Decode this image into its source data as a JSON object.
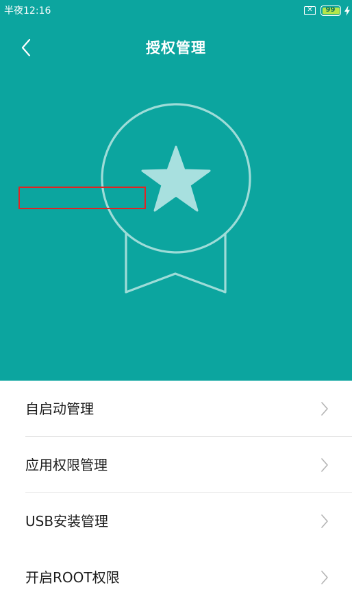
{
  "status_bar": {
    "time": "半夜12:16",
    "battery_level": "99",
    "sim_icon": "sim-disabled-icon",
    "charging_icon": "charging-bolt-icon"
  },
  "header": {
    "title": "授权管理",
    "back_icon": "back-arrow-icon"
  },
  "hero": {
    "icon": "award-medal-star-icon",
    "background_color": "#0ca59f"
  },
  "menu": {
    "items": [
      {
        "label": "自启动管理",
        "icon": "chevron-right-icon"
      },
      {
        "label": "应用权限管理",
        "icon": "chevron-right-icon"
      },
      {
        "label": "USB安装管理",
        "icon": "chevron-right-icon"
      },
      {
        "label": "开启ROOT权限",
        "icon": "chevron-right-icon",
        "highlighted": true
      }
    ]
  },
  "colors": {
    "accent": "#0ca59f",
    "highlight_box": "#e02424",
    "star": "#a8e0df"
  }
}
